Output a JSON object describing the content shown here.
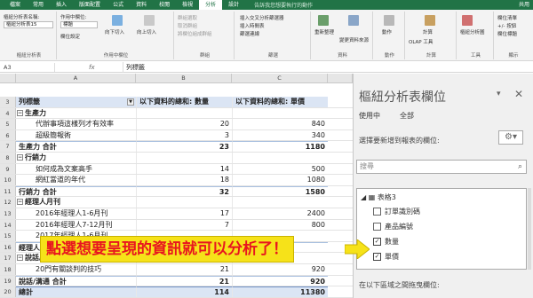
{
  "ribbon": {
    "tabs": [
      "檔案",
      "常用",
      "插入",
      "版面配置",
      "公式",
      "資料",
      "校閱",
      "檢視",
      "分析",
      "設計"
    ],
    "active_tab": "分析",
    "tell_me": "告訴我您想要執行的動作",
    "share": "共用",
    "pivot_name_label": "樞紐分析表名稱:",
    "pivot_name": "樞紐分析表15",
    "active_field_label": "作用中欄位:",
    "active_field_value": "標題",
    "field_settings": "欄位設定",
    "drill_down": "向下切入",
    "drill_up": "向上切入",
    "group_selection": "群組選取",
    "ungroup": "取消群組",
    "group_field": "將欄位組成群組",
    "insert_slicer": "插入交叉分析篩選器",
    "insert_timeline": "插入時間表",
    "filter_connections": "篩選連線",
    "refresh": "重新整理",
    "change_source": "變更資料來源",
    "actions": "動作",
    "calculations": "計算",
    "pivot_chart": "樞紐分析圖",
    "recommended": "建議的樞紐分析表",
    "field_list": "欄位清單",
    "buttons": "+/- 按鈕",
    "field_headers": "欄位標題",
    "group_labels": [
      "樞紐分析表",
      "作用中欄位",
      "群組",
      "篩選",
      "資料",
      "動作",
      "計算",
      "工具",
      "顯示"
    ],
    "olap": "OLAP 工具"
  },
  "formula_bar": {
    "name_box": "A3",
    "fx": "fx",
    "value": "列標籤"
  },
  "sheet": {
    "columns": [
      "A",
      "B",
      "C"
    ],
    "header": {
      "row": "3",
      "a": "列標籤",
      "b": "以下資料的總和: 數量",
      "c": "以下資料的總和: 單價"
    },
    "rows": [
      {
        "rn": "4",
        "type": "cat",
        "a": "生產力",
        "b": "",
        "c": ""
      },
      {
        "rn": "5",
        "type": "item",
        "a": "代辦事項這樣列才有效率",
        "b": "20",
        "c": "840"
      },
      {
        "rn": "6",
        "type": "item",
        "a": "超級簡報術",
        "b": "3",
        "c": "340"
      },
      {
        "rn": "7",
        "type": "subtot",
        "a": "生產力 合計",
        "b": "23",
        "c": "1180"
      },
      {
        "rn": "8",
        "type": "cat",
        "a": "行銷力",
        "b": "",
        "c": ""
      },
      {
        "rn": "9",
        "type": "item",
        "a": "如何成為文案高手",
        "b": "14",
        "c": "500"
      },
      {
        "rn": "10",
        "type": "item",
        "a": "網紅當道的年代",
        "b": "18",
        "c": "1080"
      },
      {
        "rn": "11",
        "type": "subtot",
        "a": "行銷力 合計",
        "b": "32",
        "c": "1580"
      },
      {
        "rn": "12",
        "type": "cat",
        "a": "經理人月刊",
        "b": "",
        "c": ""
      },
      {
        "rn": "13",
        "type": "item",
        "a": "2016年經理人1-6月刊",
        "b": "17",
        "c": "2400"
      },
      {
        "rn": "14",
        "type": "item",
        "a": "2016年經理人7-12月刊",
        "b": "7",
        "c": "800"
      },
      {
        "rn": "15",
        "type": "item",
        "a": "2017年經理人1-6月刊",
        "b": "",
        "c": ""
      },
      {
        "rn": "16",
        "type": "subtot",
        "a": "經理人月刊 合計",
        "b": "",
        "c": ""
      },
      {
        "rn": "17",
        "type": "cat",
        "a": "說話/溝通",
        "b": "",
        "c": ""
      },
      {
        "rn": "18",
        "type": "item",
        "a": "20門有關談判的技巧",
        "b": "21",
        "c": "920"
      },
      {
        "rn": "19",
        "type": "subtot",
        "a": "說話/溝通 合計",
        "b": "21",
        "c": "920"
      },
      {
        "rn": "20",
        "type": "total",
        "a": "總計",
        "b": "114",
        "c": "11380"
      }
    ]
  },
  "pane": {
    "title": "樞紐分析表欄位",
    "tab_active": "使用中",
    "tab_all": "全部",
    "choose_fields": "選擇要新增到報表的欄位:",
    "search_placeholder": "搜尋",
    "table_name": "表格3",
    "fields": [
      {
        "label": "訂單識別碼",
        "checked": false
      },
      {
        "label": "產品編號",
        "checked": false
      },
      {
        "label": "數量",
        "checked": true
      },
      {
        "label": "單價",
        "checked": true
      }
    ],
    "drag_area": "在以下區域之間拖曳欄位:"
  },
  "annotation": {
    "text": "點選想要呈現的資訊就可以分析了！"
  },
  "colors": {
    "accent": "#217346",
    "pivot_header": "#dbe5f4",
    "annotation_bg": "#f6e219",
    "annotation_text": "#e8151f"
  }
}
